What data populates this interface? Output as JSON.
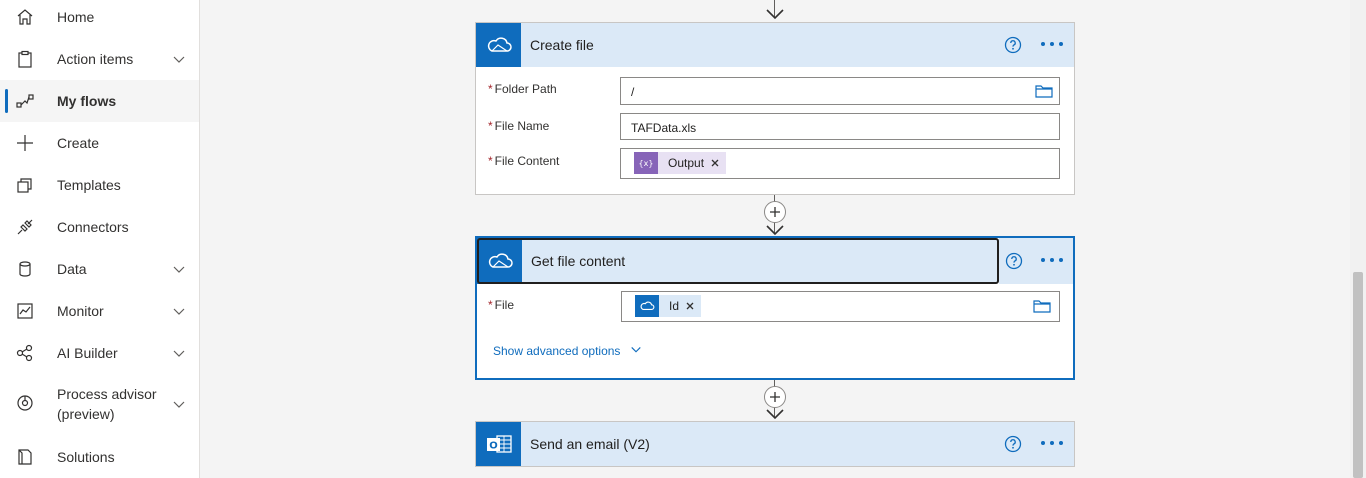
{
  "sidebar": {
    "items": [
      {
        "label": "Home",
        "icon": "home-icon"
      },
      {
        "label": "Action items",
        "icon": "clipboard-icon",
        "expandable": true
      },
      {
        "label": "My flows",
        "icon": "flow-icon",
        "active": true
      },
      {
        "label": "Create",
        "icon": "plus-icon"
      },
      {
        "label": "Templates",
        "icon": "templates-icon"
      },
      {
        "label": "Connectors",
        "icon": "connector-icon"
      },
      {
        "label": "Data",
        "icon": "database-icon",
        "expandable": true
      },
      {
        "label": "Monitor",
        "icon": "monitor-icon",
        "expandable": true
      },
      {
        "label": "AI Builder",
        "icon": "ai-builder-icon",
        "expandable": true
      },
      {
        "label": "Process advisor",
        "label2": "(preview)",
        "icon": "process-advisor-icon",
        "expandable": true
      },
      {
        "label": "Solutions",
        "icon": "solutions-icon"
      }
    ]
  },
  "flow": {
    "create_file": {
      "title": "Create file",
      "fields": {
        "folder_path": {
          "label": "Folder Path",
          "value": "/"
        },
        "file_name": {
          "label": "File Name",
          "value": "TAFData.xls"
        },
        "file_content": {
          "label": "File Content",
          "token": "Output"
        }
      }
    },
    "get_file_content": {
      "title": "Get file content",
      "fields": {
        "file": {
          "label": "File",
          "token": "Id"
        }
      },
      "advanced_link": "Show advanced options"
    },
    "send_email": {
      "title": "Send an email (V2)"
    }
  },
  "colors": {
    "accent": "#0f6cbd",
    "header_bg": "#dbe9f7",
    "expression_token": "#8764b8",
    "required": "#a4262c"
  }
}
